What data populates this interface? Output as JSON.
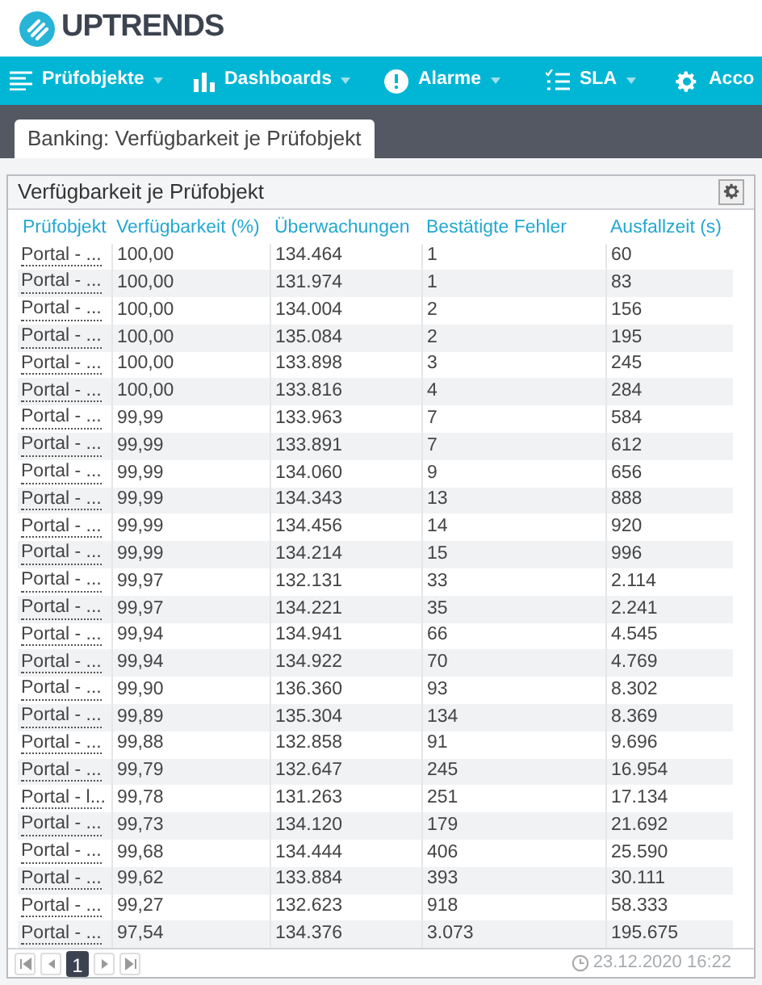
{
  "logo": {
    "text": "UPTRENDS"
  },
  "nav": [
    {
      "label": "Prüfobjekte",
      "dropdown": true
    },
    {
      "label": "Dashboards",
      "dropdown": true
    },
    {
      "label": "Alarme",
      "dropdown": true
    },
    {
      "label": "SLA",
      "dropdown": true
    },
    {
      "label": "Acco",
      "dropdown": false
    }
  ],
  "tabs": [
    {
      "label": "Banking: Verfügbarkeit je Prüfobjekt",
      "selected": true
    }
  ],
  "panel": {
    "title": "Verfügbarkeit je Prüfobjekt",
    "table": {
      "columns": [
        "Prüfobjekt",
        "Verfügbarkeit (%)",
        "Überwachungen",
        "Bestätigte Fehler",
        "Ausfallzeit (s)"
      ],
      "rows": [
        [
          "Portal - ...",
          "100,00",
          "134.464",
          "1",
          "60"
        ],
        [
          "Portal - ...",
          "100,00",
          "131.974",
          "1",
          "83"
        ],
        [
          "Portal - ...",
          "100,00",
          "134.004",
          "2",
          "156"
        ],
        [
          "Portal - ...",
          "100,00",
          "135.084",
          "2",
          "195"
        ],
        [
          "Portal - ...",
          "100,00",
          "133.898",
          "3",
          "245"
        ],
        [
          "Portal - ...",
          "100,00",
          "133.816",
          "4",
          "284"
        ],
        [
          "Portal - ...",
          "99,99",
          "133.963",
          "7",
          "584"
        ],
        [
          "Portal - ...",
          "99,99",
          "133.891",
          "7",
          "612"
        ],
        [
          "Portal - ...",
          "99,99",
          "134.060",
          "9",
          "656"
        ],
        [
          "Portal - ...",
          "99,99",
          "134.343",
          "13",
          "888"
        ],
        [
          "Portal - ...",
          "99,99",
          "134.456",
          "14",
          "920"
        ],
        [
          "Portal - ...",
          "99,99",
          "134.214",
          "15",
          "996"
        ],
        [
          "Portal - ...",
          "99,97",
          "132.131",
          "33",
          "2.114"
        ],
        [
          "Portal - ...",
          "99,97",
          "134.221",
          "35",
          "2.241"
        ],
        [
          "Portal - ...",
          "99,94",
          "134.941",
          "66",
          "4.545"
        ],
        [
          "Portal - ...",
          "99,94",
          "134.922",
          "70",
          "4.769"
        ],
        [
          "Portal - ...",
          "99,90",
          "136.360",
          "93",
          "8.302"
        ],
        [
          "Portal - ...",
          "99,89",
          "135.304",
          "134",
          "8.369"
        ],
        [
          "Portal - ...",
          "99,88",
          "132.858",
          "91",
          "9.696"
        ],
        [
          "Portal - ...",
          "99,79",
          "132.647",
          "245",
          "16.954"
        ],
        [
          "Portal - l...",
          "99,78",
          "131.263",
          "251",
          "17.134"
        ],
        [
          "Portal - ...",
          "99,73",
          "134.120",
          "179",
          "21.692"
        ],
        [
          "Portal - ...",
          "99,68",
          "134.444",
          "406",
          "25.590"
        ],
        [
          "Portal - ...",
          "99,62",
          "133.884",
          "393",
          "30.111"
        ],
        [
          "Portal - ...",
          "99,27",
          "132.623",
          "918",
          "58.333"
        ],
        [
          "Portal - ...",
          "97,54",
          "134.376",
          "3.073",
          "195.675"
        ]
      ]
    },
    "pager": [
      {
        "kind": "first"
      },
      {
        "kind": "prev"
      },
      {
        "kind": "page",
        "label": "1",
        "selected": true
      },
      {
        "kind": "next"
      },
      {
        "kind": "last"
      }
    ],
    "timestamp": "23.12.2020 16:22"
  }
}
